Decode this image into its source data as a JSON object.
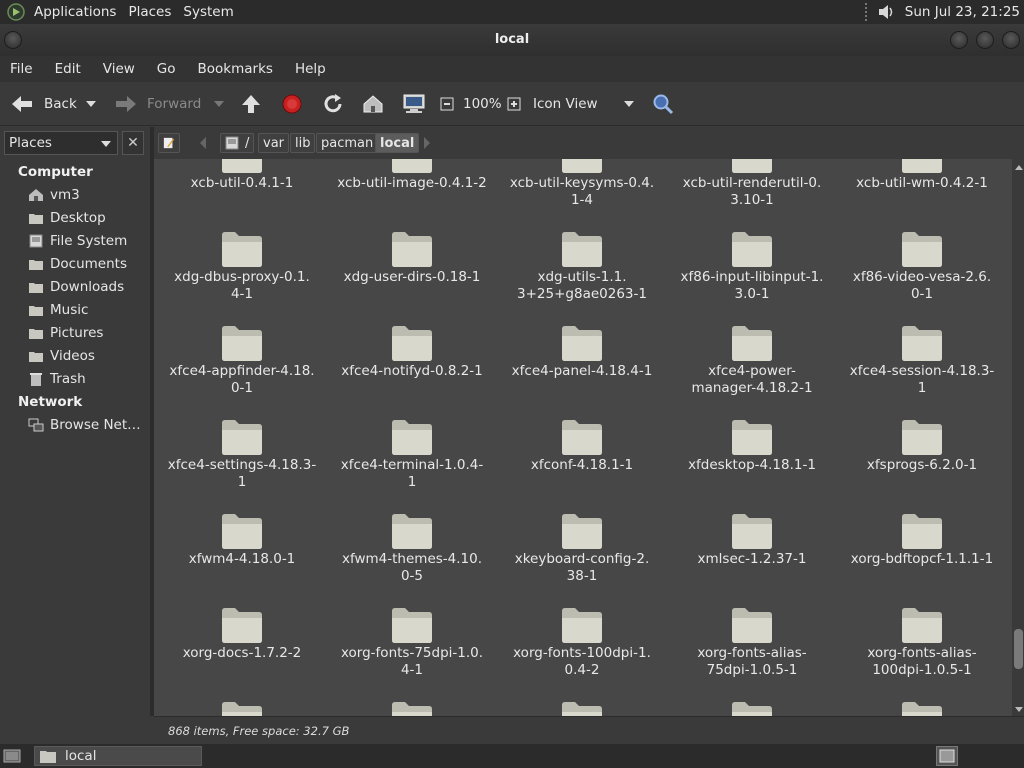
{
  "top_panel": {
    "menus": [
      "Applications",
      "Places",
      "System"
    ],
    "clock": "Sun Jul 23, 21:25"
  },
  "window": {
    "title": "local"
  },
  "menubar": [
    "File",
    "Edit",
    "View",
    "Go",
    "Bookmarks",
    "Help"
  ],
  "toolbar": {
    "back_label": "Back",
    "forward_label": "Forward",
    "zoom": "100%",
    "view_mode": "Icon View"
  },
  "sidebar": {
    "combo_label": "Places",
    "computer_heading": "Computer",
    "computer_items": [
      {
        "label": "vm3",
        "icon": "home-icon"
      },
      {
        "label": "Desktop",
        "icon": "desktop-icon"
      },
      {
        "label": "File System",
        "icon": "drive-icon"
      },
      {
        "label": "Documents",
        "icon": "folder-icon"
      },
      {
        "label": "Downloads",
        "icon": "folder-icon"
      },
      {
        "label": "Music",
        "icon": "folder-icon"
      },
      {
        "label": "Pictures",
        "icon": "folder-icon"
      },
      {
        "label": "Videos",
        "icon": "folder-icon"
      },
      {
        "label": "Trash",
        "icon": "trash-icon"
      }
    ],
    "network_heading": "Network",
    "network_items": [
      {
        "label": "Browse Net…",
        "icon": "network-icon"
      }
    ]
  },
  "breadcrumb": [
    "/",
    "var",
    "lib",
    "pacman",
    "local"
  ],
  "files": [
    [
      "xcb-util-0.4.1-1",
      "xcb-util-image-0.4.1-2",
      "xcb-util-keysyms-0.4.\n1-4",
      "xcb-util-renderutil-0.\n3.10-1",
      "xcb-util-wm-0.4.2-1"
    ],
    [
      "xdg-dbus-proxy-0.1.\n4-1",
      "xdg-user-dirs-0.18-1",
      "xdg-utils-1.1.\n3+25+g8ae0263-1",
      "xf86-input-libinput-1.\n3.0-1",
      "xf86-video-vesa-2.6.\n0-1"
    ],
    [
      "xfce4-appfinder-4.18.\n0-1",
      "xfce4-notifyd-0.8.2-1",
      "xfce4-panel-4.18.4-1",
      "xfce4-power-\nmanager-4.18.2-1",
      "xfce4-session-4.18.3-\n1"
    ],
    [
      "xfce4-settings-4.18.3-\n1",
      "xfce4-terminal-1.0.4-1",
      "xfconf-4.18.1-1",
      "xfdesktop-4.18.1-1",
      "xfsprogs-6.2.0-1"
    ],
    [
      "xfwm4-4.18.0-1",
      "xfwm4-themes-4.10.\n0-5",
      "xkeyboard-config-2.\n38-1",
      "xmlsec-1.2.37-1",
      "xorg-bdftopcf-1.1.1-1"
    ],
    [
      "xorg-docs-1.7.2-2",
      "xorg-fonts-75dpi-1.0.\n4-1",
      "xorg-fonts-100dpi-1.\n0.4-2",
      "xorg-fonts-alias-\n75dpi-1.0.5-1",
      "xorg-fonts-alias-\n100dpi-1.0.5-1"
    ]
  ],
  "status": "868 items, Free space: 32.7 GB",
  "taskbar": {
    "task_label": "local"
  }
}
